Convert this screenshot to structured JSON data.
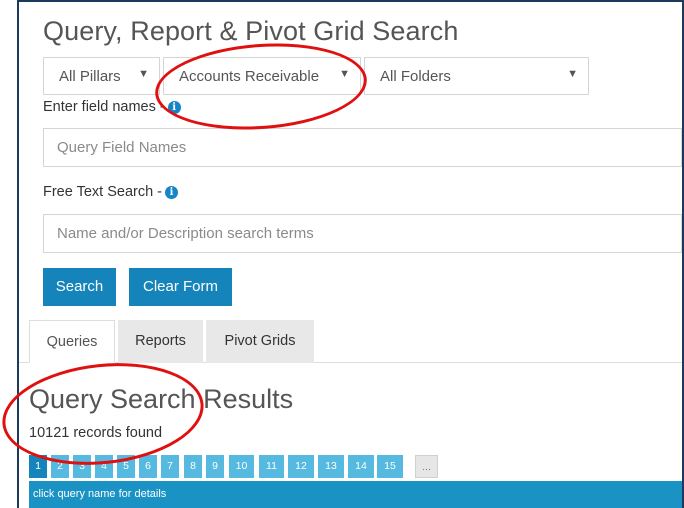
{
  "page": {
    "title": "Query, Report & Pivot Grid Search"
  },
  "filters": {
    "pillar": "All Pillars",
    "module": "Accounts Receivable",
    "folder": "All Folders"
  },
  "fields": {
    "field_names_label": "Enter field names -",
    "field_names_placeholder": "Query Field Names",
    "free_text_label": "Free Text Search -",
    "free_text_placeholder": "Name and/or Description search terms"
  },
  "buttons": {
    "search": "Search",
    "clear": "Clear Form"
  },
  "tabs": [
    "Queries",
    "Reports",
    "Pivot Grids"
  ],
  "results": {
    "title": "Query Search Results",
    "count_text": "10121 records found",
    "pages": [
      "1",
      "2",
      "3",
      "4",
      "5",
      "6",
      "7",
      "8",
      "9",
      "10",
      "11",
      "12",
      "13",
      "14",
      "15"
    ],
    "more": "...",
    "hint": "click query name for details"
  },
  "icons": {
    "info": "info-icon",
    "dropdown": "chevron-down-icon"
  },
  "colors": {
    "primary": "#1484bb",
    "page_button": "#55b9e0",
    "annotation": "#e01010"
  }
}
